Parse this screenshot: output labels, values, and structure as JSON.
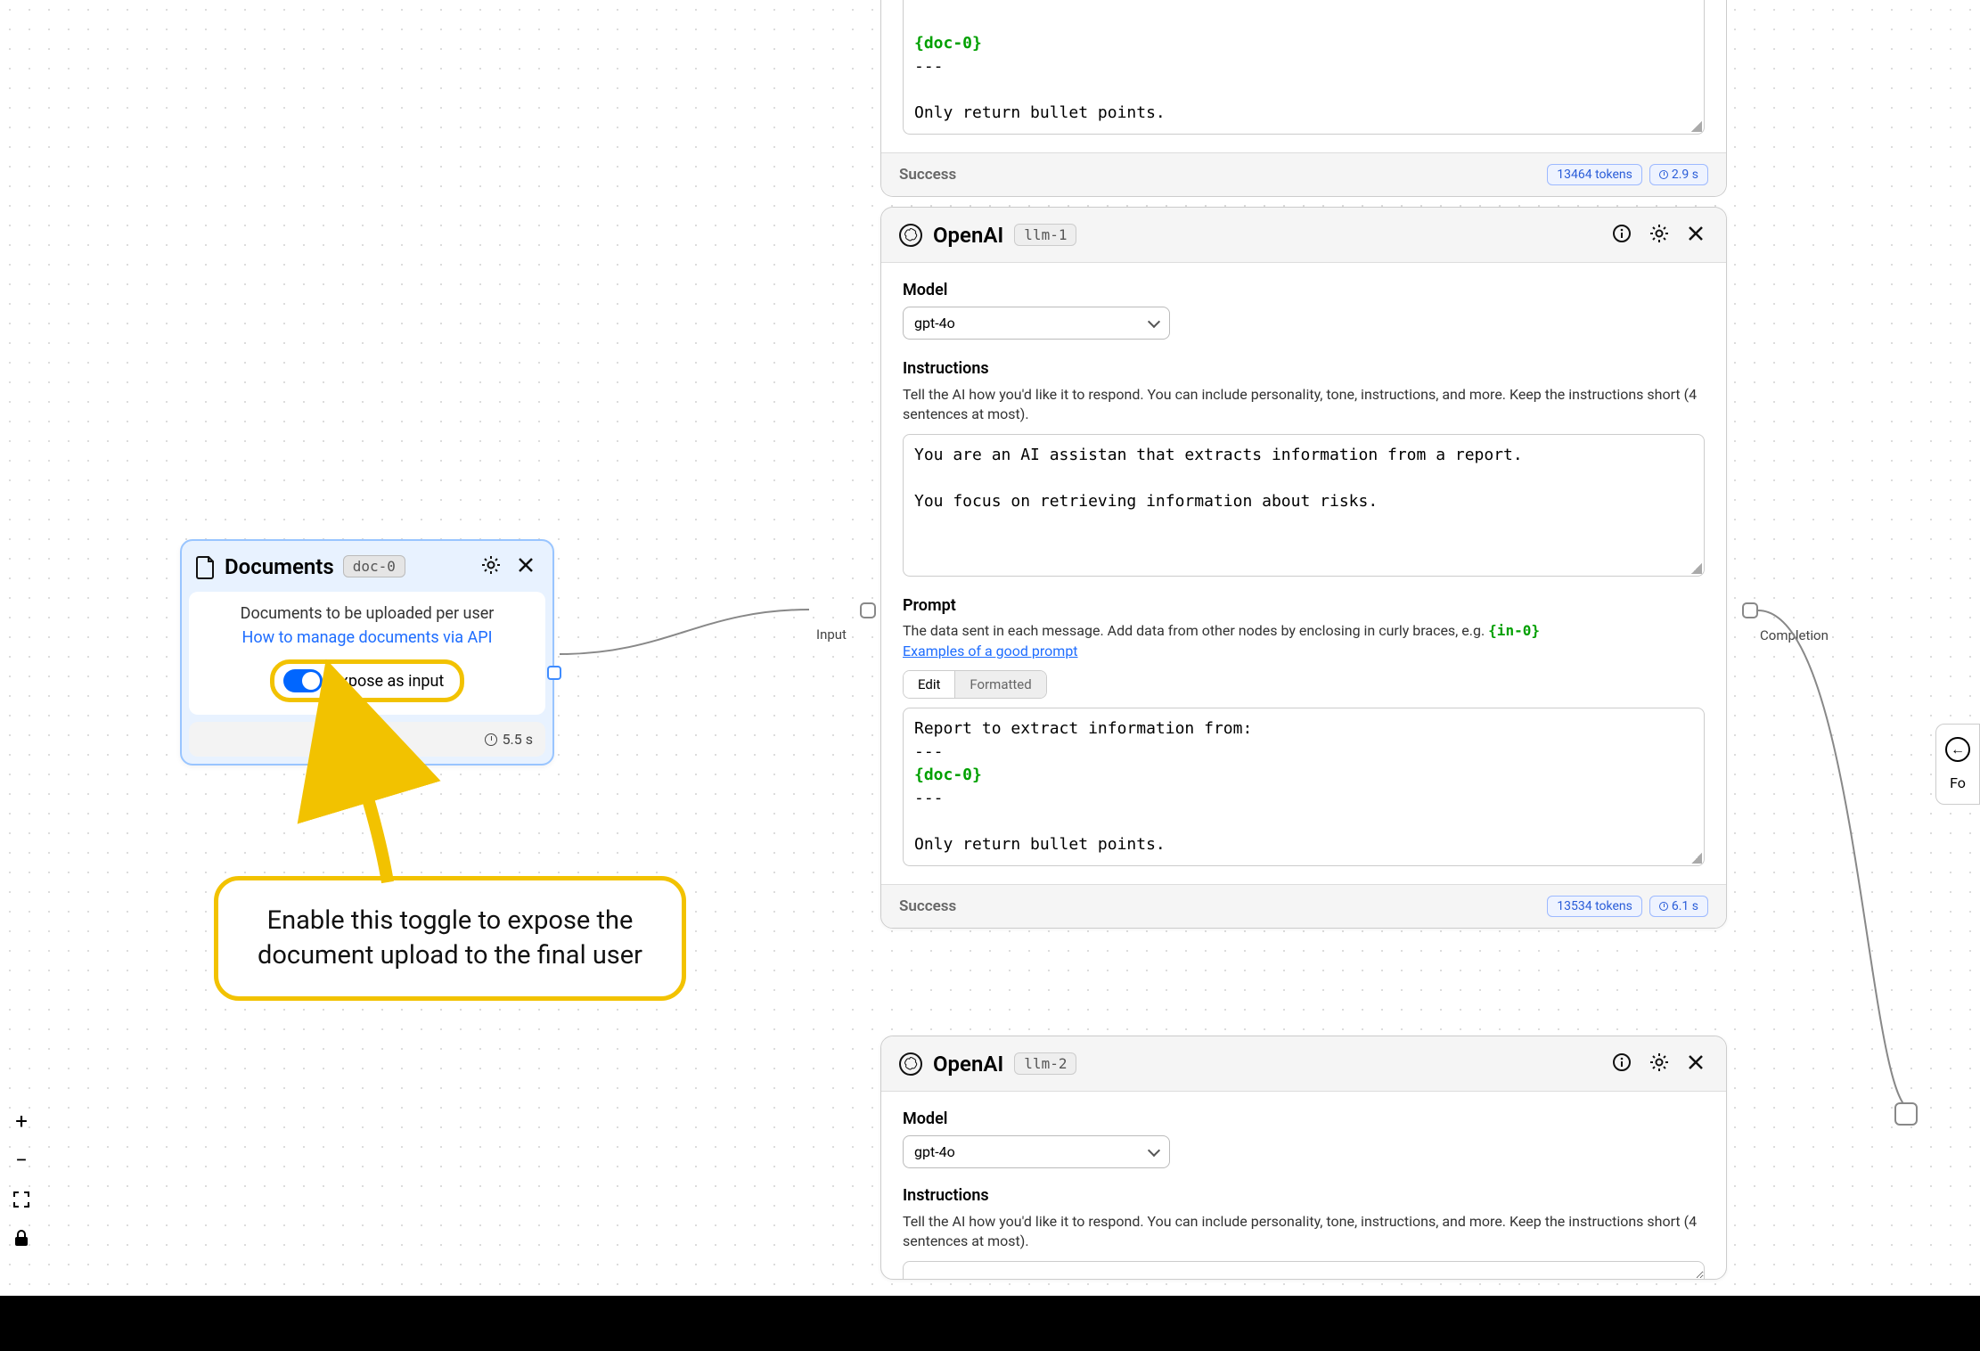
{
  "documents_node": {
    "title": "Documents",
    "id": "doc-0",
    "subtitle": "Documents to be uploaded per user",
    "link": "How to manage documents via API",
    "toggle_label": "Expose as input",
    "time": "5.5 s"
  },
  "input_label": "Input",
  "completion_label": "Completion",
  "right_panel_label": "Fo",
  "callout_text": "Enable this toggle to expose the document upload to the final user",
  "partial_top_node": {
    "doc_ref": "{doc-0}",
    "suffix_line": "---",
    "last_line": "Only return bullet points.",
    "status": "Success",
    "tokens": "13464 tokens",
    "time": "2.9 s"
  },
  "llm_common": {
    "model_label": "Model",
    "model_value": "gpt-4o",
    "instructions_label": "Instructions",
    "instructions_help": "Tell the AI how you'd like it to respond. You can include personality, tone, instructions, and more. Keep the instructions short (4 sentences at most).",
    "instructions_text": "You are an AI assistan that extracts information from a report.\n\nYou focus on retrieving information about risks.",
    "prompt_label": "Prompt",
    "prompt_help_prefix": "The data sent in each message. Add data from other nodes by enclosing in curly braces, e.g. ",
    "prompt_help_ph": "{in-0}",
    "examples_link": "Examples of a good prompt",
    "tab_edit": "Edit",
    "tab_formatted": "Formatted",
    "prompt_line1": "Report to extract information from:",
    "prompt_sep": "---",
    "prompt_docref": "{doc-0}",
    "prompt_last": "Only return bullet points.",
    "status": "Success"
  },
  "llm1": {
    "name": "OpenAI",
    "id": "llm-1",
    "tokens": "13534 tokens",
    "time": "6.1 s"
  },
  "llm2": {
    "name": "OpenAI",
    "id": "llm-2"
  }
}
